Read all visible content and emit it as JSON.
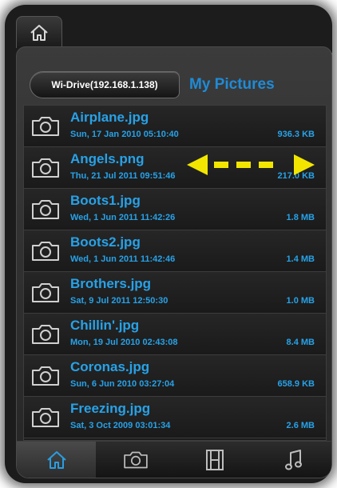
{
  "header": {
    "server_button": "Wi-Drive(192.168.1.138)",
    "title": "My Pictures"
  },
  "files": [
    {
      "name": "Airplane.jpg",
      "date": "Sun, 17 Jan 2010 05:10:40",
      "size": "936.3 KB"
    },
    {
      "name": "Angels.png",
      "date": "Thu, 21 Jul 2011 09:51:46",
      "size": "217.0 KB"
    },
    {
      "name": "Boots1.jpg",
      "date": "Wed, 1 Jun 2011 11:42:26",
      "size": "1.8 MB"
    },
    {
      "name": "Boots2.jpg",
      "date": "Wed, 1 Jun 2011 11:42:46",
      "size": "1.4 MB"
    },
    {
      "name": "Brothers.jpg",
      "date": "Sat, 9 Jul 2011 12:50:30",
      "size": "1.0 MB"
    },
    {
      "name": "Chillin'.jpg",
      "date": "Mon, 19 Jul 2010 02:43:08",
      "size": "8.4 MB"
    },
    {
      "name": "Coronas.jpg",
      "date": "Sun, 6 Jun 2010 03:27:04",
      "size": "658.9 KB"
    },
    {
      "name": "Freezing.jpg",
      "date": "Sat, 3 Oct 2009 03:01:34",
      "size": "2.6 MB"
    }
  ],
  "tabs": [
    {
      "icon": "home-icon",
      "active": true
    },
    {
      "icon": "camera-icon",
      "active": false
    },
    {
      "icon": "film-icon",
      "active": false
    },
    {
      "icon": "music-note-icon",
      "active": false
    }
  ],
  "colors": {
    "accent": "#27a2e8",
    "title": "#1f8bd6",
    "swipe_arrow": "#f2e600"
  },
  "swipe_hint_icon": "double-arrow-icon"
}
